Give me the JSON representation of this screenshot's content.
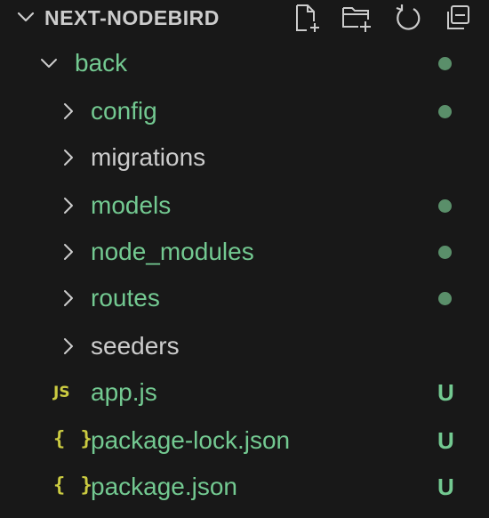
{
  "explorer": {
    "title": "NEXT-NODEBIRD",
    "actions": [
      {
        "name": "new-file",
        "icon": "new-file-icon"
      },
      {
        "name": "new-folder",
        "icon": "new-folder-icon"
      },
      {
        "name": "refresh",
        "icon": "refresh-icon"
      },
      {
        "name": "collapse-all",
        "icon": "collapse-all-icon"
      }
    ]
  },
  "tree": {
    "root": {
      "label": "back",
      "expanded": true,
      "status": "modified-dot"
    },
    "items": [
      {
        "label": "config",
        "type": "folder",
        "status": "modified-dot"
      },
      {
        "label": "migrations",
        "type": "folder",
        "status": "none"
      },
      {
        "label": "models",
        "type": "folder",
        "status": "modified-dot"
      },
      {
        "label": "node_modules",
        "type": "folder",
        "status": "modified-dot"
      },
      {
        "label": "routes",
        "type": "folder",
        "status": "modified-dot"
      },
      {
        "label": "seeders",
        "type": "folder",
        "status": "none"
      },
      {
        "label": "app.js",
        "type": "file",
        "file_icon": "JS",
        "status": "U"
      },
      {
        "label": "package-lock.json",
        "type": "file",
        "file_icon": "{ }",
        "status": "U"
      },
      {
        "label": "package.json",
        "type": "file",
        "file_icon": "{ }",
        "status": "U"
      }
    ]
  },
  "colors": {
    "background": "#181818",
    "text": "#cccccc",
    "git_green": "#73c991",
    "dot_green": "#5a8f6a",
    "icon_yellow": "#cbcb41"
  }
}
